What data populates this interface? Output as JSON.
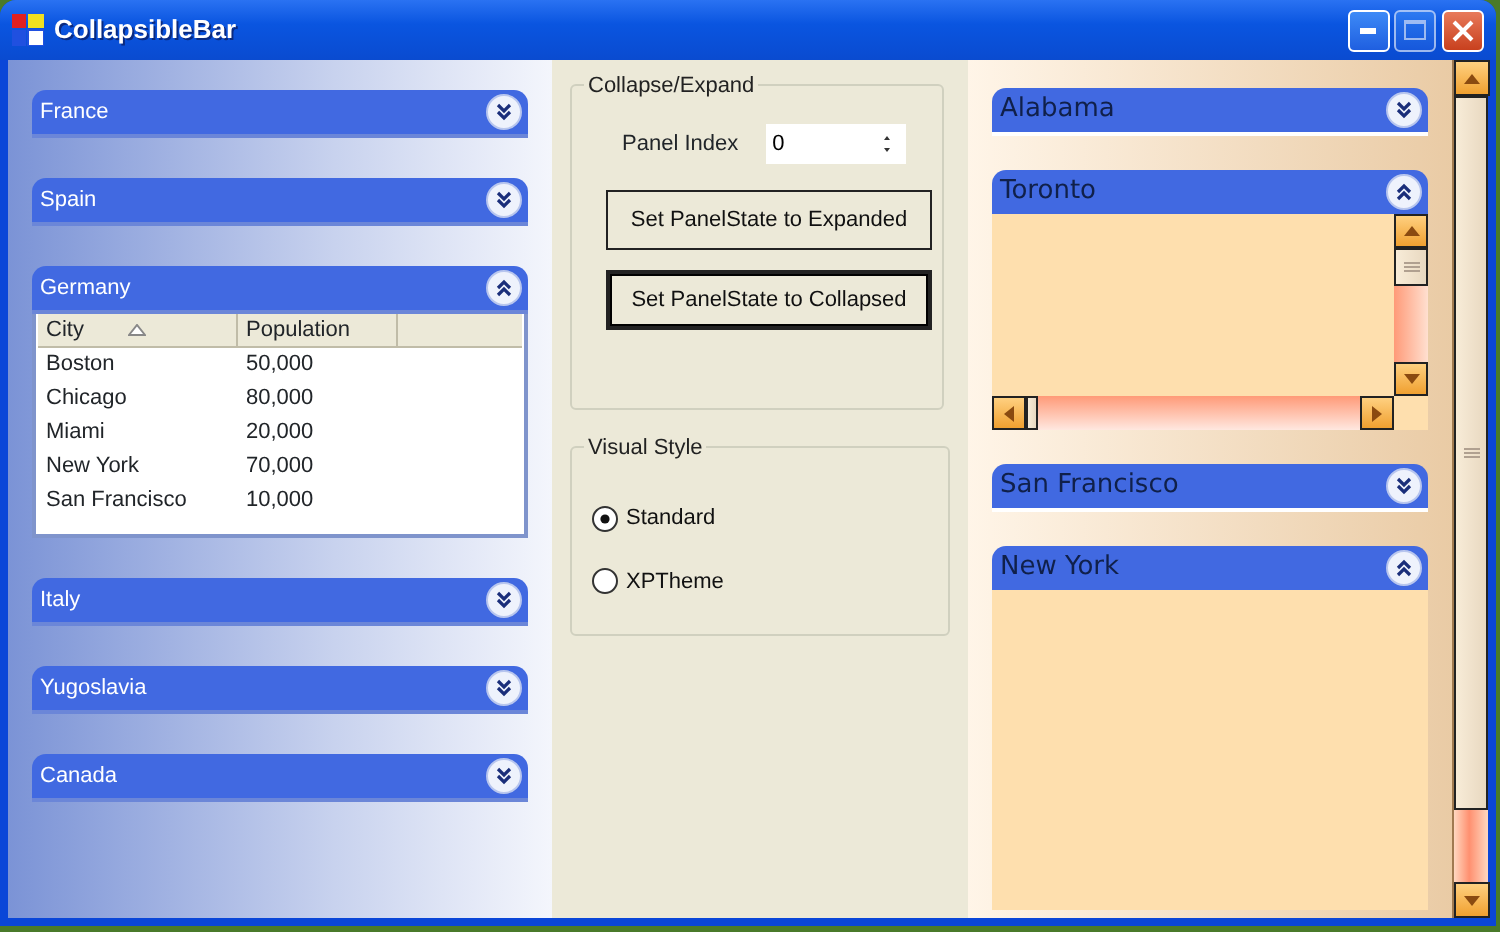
{
  "window": {
    "title": "CollapsibleBar"
  },
  "left_panels": [
    {
      "title": "France",
      "expanded": false
    },
    {
      "title": "Spain",
      "expanded": false
    },
    {
      "title": "Germany",
      "expanded": true,
      "table": {
        "columns": [
          {
            "label": "City",
            "sorted": true
          },
          {
            "label": "Population",
            "sorted": false
          }
        ],
        "rows": [
          [
            "Boston",
            "50,000"
          ],
          [
            "Chicago",
            "80,000"
          ],
          [
            "Miami",
            "20,000"
          ],
          [
            "New York",
            "70,000"
          ],
          [
            "San Francisco",
            "10,000"
          ]
        ]
      }
    },
    {
      "title": "Italy",
      "expanded": false
    },
    {
      "title": "Yugoslavia",
      "expanded": false
    },
    {
      "title": "Canada",
      "expanded": false
    }
  ],
  "collapse_expand": {
    "title": "Collapse/Expand",
    "panel_index_label": "Panel Index",
    "panel_index_value": "0",
    "buttons": [
      {
        "label": "Set PanelState to Expanded",
        "focused": false
      },
      {
        "label": "Set PanelState to Collapsed",
        "focused": true
      }
    ]
  },
  "visual_style": {
    "title": "Visual Style",
    "options": [
      {
        "label": "Standard",
        "selected": true
      },
      {
        "label": "XPTheme",
        "selected": false
      }
    ]
  },
  "right_panels": [
    {
      "title": "Alabama",
      "expanded": false
    },
    {
      "title": "Toronto",
      "expanded": true,
      "kind": "scrolling"
    },
    {
      "title": "San Francisco",
      "expanded": false
    },
    {
      "title": "New York",
      "expanded": true,
      "kind": "plain"
    }
  ]
}
